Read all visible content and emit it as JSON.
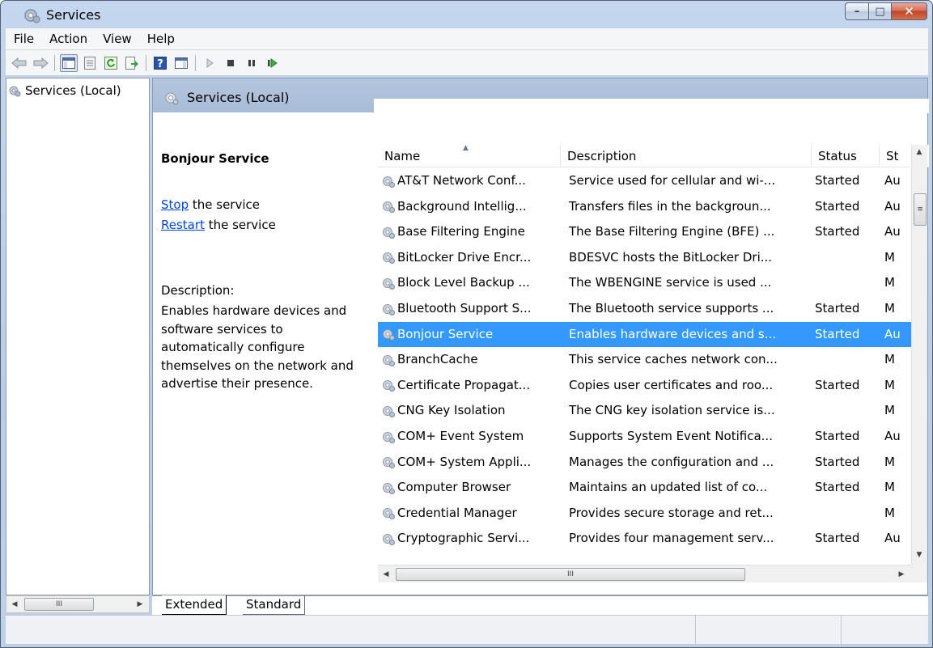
{
  "window": {
    "title": "Services",
    "caption_buttons": {
      "minimize": "–",
      "maximize": "□",
      "close": "✕"
    }
  },
  "menu": [
    {
      "label": "File"
    },
    {
      "label": "Action"
    },
    {
      "label": "View"
    },
    {
      "label": "Help"
    }
  ],
  "toolbar": {
    "buttons": [
      "back-icon",
      "forward-icon",
      "show-hide-console-tree-icon",
      "properties-icon",
      "refresh-icon",
      "export-list-icon",
      "help-icon",
      "show-action-pane-icon",
      "start-service-icon",
      "stop-service-icon",
      "pause-service-icon",
      "restart-service-icon"
    ]
  },
  "tree": {
    "items": [
      {
        "label": "Services (Local)"
      }
    ],
    "hscroll_glyph": "III"
  },
  "pane": {
    "header_title": "Services (Local)",
    "selected_service_name": "Bonjour Service",
    "actions": [
      {
        "link": "Stop",
        "rest": " the service"
      },
      {
        "link": "Restart",
        "rest": " the service"
      }
    ],
    "description_label": "Description:",
    "description_text": "Enables hardware devices and software services to automatically configure themselves on the network and advertise their presence."
  },
  "list": {
    "columns": [
      "Name",
      "Description",
      "Status",
      "St"
    ],
    "sorted_column": "Name",
    "rows": [
      {
        "name": "AT&T Network Conf...",
        "description": "Service used for cellular and wi-...",
        "status": "Started",
        "startup": "Au"
      },
      {
        "name": "Background Intellig...",
        "description": "Transfers files in the backgroun...",
        "status": "Started",
        "startup": "Au"
      },
      {
        "name": "Base Filtering Engine",
        "description": "The Base Filtering Engine (BFE) ...",
        "status": "Started",
        "startup": "Au"
      },
      {
        "name": "BitLocker Drive Encr...",
        "description": "BDESVC hosts the BitLocker Dri...",
        "status": "",
        "startup": "M"
      },
      {
        "name": "Block Level Backup ...",
        "description": "The WBENGINE service is used ...",
        "status": "",
        "startup": "M"
      },
      {
        "name": "Bluetooth Support S...",
        "description": "The Bluetooth service supports ...",
        "status": "Started",
        "startup": "M"
      },
      {
        "name": "Bonjour Service",
        "description": "Enables hardware devices and s...",
        "status": "Started",
        "startup": "Au",
        "selected": true
      },
      {
        "name": "BranchCache",
        "description": "This service caches network con...",
        "status": "",
        "startup": "M"
      },
      {
        "name": "Certificate Propagat...",
        "description": "Copies user certificates and roo...",
        "status": "Started",
        "startup": "M"
      },
      {
        "name": "CNG Key Isolation",
        "description": "The CNG key isolation service is...",
        "status": "",
        "startup": "M"
      },
      {
        "name": "COM+ Event System",
        "description": "Supports System Event Notifica...",
        "status": "Started",
        "startup": "Au"
      },
      {
        "name": "COM+ System Appli...",
        "description": "Manages the configuration and ...",
        "status": "Started",
        "startup": "M"
      },
      {
        "name": "Computer Browser",
        "description": "Maintains an updated list of co...",
        "status": "Started",
        "startup": "M"
      },
      {
        "name": "Credential Manager",
        "description": "Provides secure storage and ret...",
        "status": "",
        "startup": "M"
      },
      {
        "name": "Cryptographic Servi...",
        "description": "Provides four management serv...",
        "status": "Started",
        "startup": "Au"
      }
    ],
    "hscroll_glyph": "III",
    "vscroll_glyph": "≡"
  },
  "tabs": [
    {
      "label": "Extended",
      "active": true
    },
    {
      "label": "Standard",
      "active": false
    }
  ],
  "colors": {
    "selection": "#3399ff",
    "link": "#0046d5",
    "header": "#a8bcd7"
  }
}
